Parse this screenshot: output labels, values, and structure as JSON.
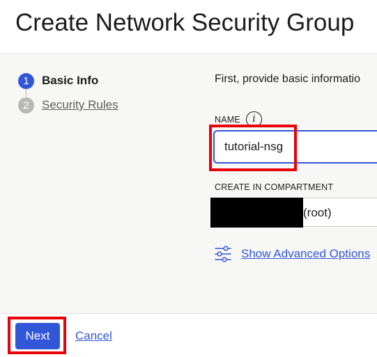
{
  "header": {
    "title": "Create Network Security Group"
  },
  "steps": [
    {
      "number": "1",
      "label": "Basic Info",
      "state": "current"
    },
    {
      "number": "2",
      "label": "Security Rules",
      "state": "upcoming"
    }
  ],
  "form": {
    "intro": "First, provide basic informatio",
    "name": {
      "label": "NAME",
      "info_glyph": "i",
      "value": "tutorial-nsg"
    },
    "compartment": {
      "label": "CREATE IN COMPARTMENT",
      "value_suffix": "(root)"
    },
    "advanced": {
      "label": "Show Advanced Options",
      "icon": "sliders-icon"
    }
  },
  "footer": {
    "next_label": "Next",
    "cancel_label": "Cancel"
  },
  "colors": {
    "accent": "#3256d8",
    "highlight": "#e8000b",
    "step_inactive": "#b8b8b6",
    "background": "#f7f7f6"
  }
}
